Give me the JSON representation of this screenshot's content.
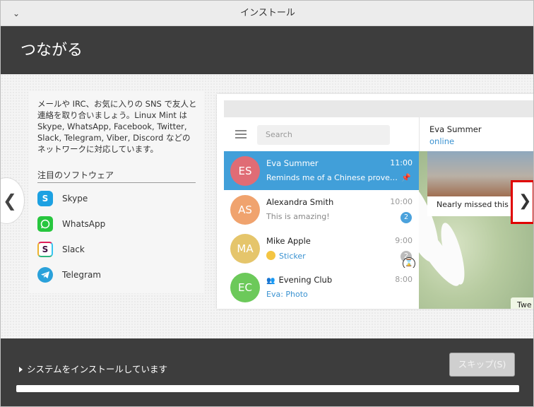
{
  "window": {
    "title": "インストール"
  },
  "header": {
    "title": "つながる"
  },
  "left_panel": {
    "description": "メールや IRC、お気に入りの SNS で友人と連絡を取り合いましょう。Linux Mint は Skype, WhatsApp, Facebook, Twitter, Slack, Telegram, Viber, Discord などのネットワークに対応しています。",
    "section_title": "注目のソフトウェア",
    "apps": [
      {
        "label": "Skype",
        "icon": "skype-icon",
        "color": "#1da1e2"
      },
      {
        "label": "WhatsApp",
        "icon": "whatsapp-icon",
        "color": "#27c63e"
      },
      {
        "label": "Slack",
        "icon": "slack-icon",
        "color": "#3f0e40"
      },
      {
        "label": "Telegram",
        "icon": "telegram-icon",
        "color": "#2aa1da"
      }
    ]
  },
  "telegram_preview": {
    "search_placeholder": "Search",
    "chats": [
      {
        "avatar": "ES",
        "avatar_color": "#e06c75",
        "name": "Eva Summer",
        "time": "11:00",
        "preview": "Reminds me of a Chinese proverb...",
        "active": true
      },
      {
        "avatar": "AS",
        "avatar_color": "#f0a36e",
        "name": "Alexandra Smith",
        "time": "10:00",
        "preview": "This is amazing!",
        "badge": "2"
      },
      {
        "avatar": "MA",
        "avatar_color": "#e5c56b",
        "name": "Mike Apple",
        "time": "9:00",
        "preview": "Sticker",
        "badge": "2"
      },
      {
        "avatar": "EC",
        "avatar_color": "#6cc95a",
        "name": "Evening Club",
        "time": "8:00",
        "preview": "Eva: Photo"
      }
    ],
    "chat_header": {
      "name": "Eva Summer",
      "status": "online"
    },
    "messages": {
      "photo_caption": "Nearly missed this s",
      "tweet": "Twe"
    }
  },
  "footer": {
    "status_text": "システムをインストールしています",
    "skip_label": "スキップ(S)",
    "progress": 0.0
  }
}
